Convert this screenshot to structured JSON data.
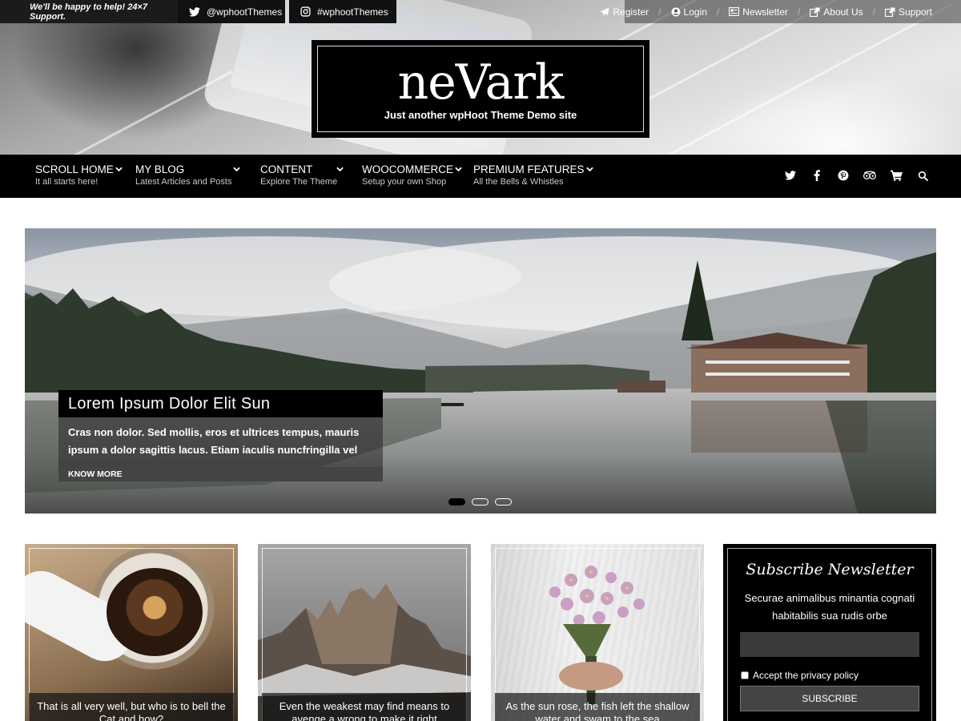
{
  "topbar": {
    "support_text": "We'll be happy to help! 24×7 Support.",
    "twitter_label": "@wphootThemes",
    "instagram_label": "#wphootThemes",
    "links": [
      {
        "label": "Register",
        "icon": "paper-plane-icon"
      },
      {
        "label": "Login",
        "icon": "user-icon"
      },
      {
        "label": "Newsletter",
        "icon": "newspaper-icon"
      },
      {
        "label": "About Us",
        "icon": "external-link-icon"
      },
      {
        "label": "Support",
        "icon": "external-link-icon"
      }
    ]
  },
  "site": {
    "title": "neVark",
    "tagline": "Just another wpHoot Theme Demo site"
  },
  "nav": {
    "items": [
      {
        "title": "SCROLL HOME",
        "desc": "It all starts here!"
      },
      {
        "title": "MY BLOG",
        "desc": "Latest Articles and Posts"
      },
      {
        "title": "CONTENT",
        "desc": "Explore The Theme"
      },
      {
        "title": "WOOCOMMERCE",
        "desc": "Setup your own Shop"
      },
      {
        "title": "PREMIUM FEATURES",
        "desc": "All the Bells & Whistles"
      }
    ],
    "social_icons": [
      "twitter-icon",
      "facebook-icon",
      "pinterest-icon",
      "tripadvisor-icon",
      "cart-icon",
      "search-icon"
    ]
  },
  "slider": {
    "title": "Lorem Ipsum Dolor Elit Sun",
    "text": "Cras non dolor. Sed mollis, eros et ultrices tempus, mauris ipsum a dolor sagittis lacus. Etiam iaculis nuncfringilla vel",
    "button": "KNOW MORE",
    "active_slide": 1,
    "slide_count": 3
  },
  "cards": [
    {
      "caption": "That is all very well, but who is to bell the Cat and how?"
    },
    {
      "caption": "Even the weakest may find means to avenge a wrong to make it right"
    },
    {
      "caption": "As the sun rose, the fish left the shallow water and swam to the sea"
    }
  ],
  "newsletter": {
    "title": "Subscribe Newsletter",
    "description": "Securae animalibus minantia cognati habitabilis sua rudis orbe",
    "email_value": "",
    "privacy_label": "Accept the privacy policy",
    "submit_label": "SUBSCRIBE"
  },
  "colors": {
    "accent": "#000000",
    "topbar_bg": "#1b1b1b",
    "nav_bg": "#000000"
  }
}
